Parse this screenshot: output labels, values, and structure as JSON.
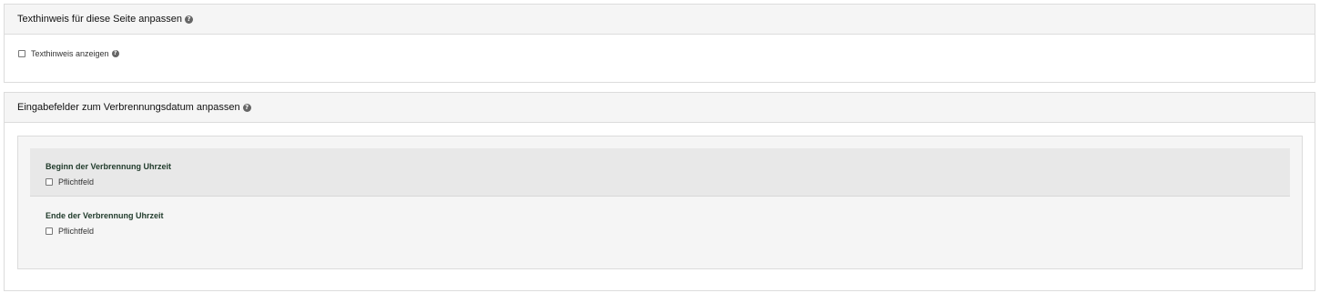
{
  "panel_text_hint": {
    "title": "Texthinweis für diese Seite anpassen",
    "checkbox_label": "Texthinweis anzeigen",
    "checkbox_checked": false
  },
  "panel_date_fields": {
    "title": "Eingabefelder zum Verbrennungsdatum anpassen",
    "fields": [
      {
        "title": "Beginn der Verbrennung Uhrzeit",
        "required_label": "Pflichtfeld",
        "required_checked": false
      },
      {
        "title": "Ende der Verbrennung Uhrzeit",
        "required_label": "Pflichtfeld",
        "required_checked": false
      }
    ]
  },
  "icons": {
    "help": "question-circle-icon"
  }
}
